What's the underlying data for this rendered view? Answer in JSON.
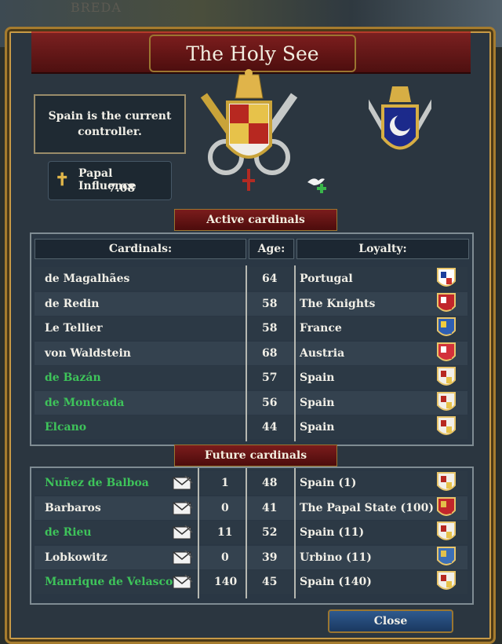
{
  "map_label": "BREDA",
  "window": {
    "title": "The Holy See",
    "controller_text": "Spain is the current controller.",
    "papal_influence_label": "Papal Influence",
    "papal_influence_value": "7.08",
    "close_label": "Close"
  },
  "active": {
    "section_title": "Active cardinals",
    "headers": {
      "name": "Cardinals:",
      "age": "Age:",
      "loyalty": "Loyalty:"
    },
    "rows": [
      {
        "name": "de Magalhães",
        "age": "64",
        "loyalty": "Portugal",
        "green": false,
        "shield": "portugal-shield-icon"
      },
      {
        "name": "de Redin",
        "age": "58",
        "loyalty": "The Knights",
        "green": false,
        "shield": "knights-shield-icon"
      },
      {
        "name": "Le Tellier",
        "age": "58",
        "loyalty": "France",
        "green": false,
        "shield": "france-shield-icon"
      },
      {
        "name": "von Waldstein",
        "age": "68",
        "loyalty": "Austria",
        "green": false,
        "shield": "austria-shield-icon"
      },
      {
        "name": "de Bazán",
        "age": "57",
        "loyalty": "Spain",
        "green": true,
        "shield": "spain-shield-icon"
      },
      {
        "name": "de Montcada",
        "age": "56",
        "loyalty": "Spain",
        "green": true,
        "shield": "spain-shield-icon"
      },
      {
        "name": "Elcano",
        "age": "44",
        "loyalty": "Spain",
        "green": true,
        "shield": "spain-shield-icon"
      }
    ]
  },
  "future": {
    "section_title": "Future cardinals",
    "rows": [
      {
        "name": "Nuñez de Balboa",
        "votes": "1",
        "age": "48",
        "loyalty": "Spain (1)",
        "green": true,
        "shield": "spain-shield-icon"
      },
      {
        "name": "Barbaros",
        "votes": "0",
        "age": "41",
        "loyalty": "The Papal State (100)",
        "green": false,
        "shield": "papal-state-shield-icon"
      },
      {
        "name": "de Rieu",
        "votes": "11",
        "age": "52",
        "loyalty": "Spain (11)",
        "green": true,
        "shield": "spain-shield-icon"
      },
      {
        "name": "Lobkowitz",
        "votes": "0",
        "age": "39",
        "loyalty": "Urbino (11)",
        "green": false,
        "shield": "urbino-shield-icon"
      },
      {
        "name": "Manrique de Velasco",
        "votes": "140",
        "age": "45",
        "loyalty": "Spain (140)",
        "green": true,
        "shield": "spain-shield-icon"
      }
    ]
  },
  "colors": {
    "green_name": "#3ec35a",
    "banner_red": "#7b1d1d",
    "gold_trim": "#a67c2e",
    "close_blue": "#2f5a8e"
  }
}
